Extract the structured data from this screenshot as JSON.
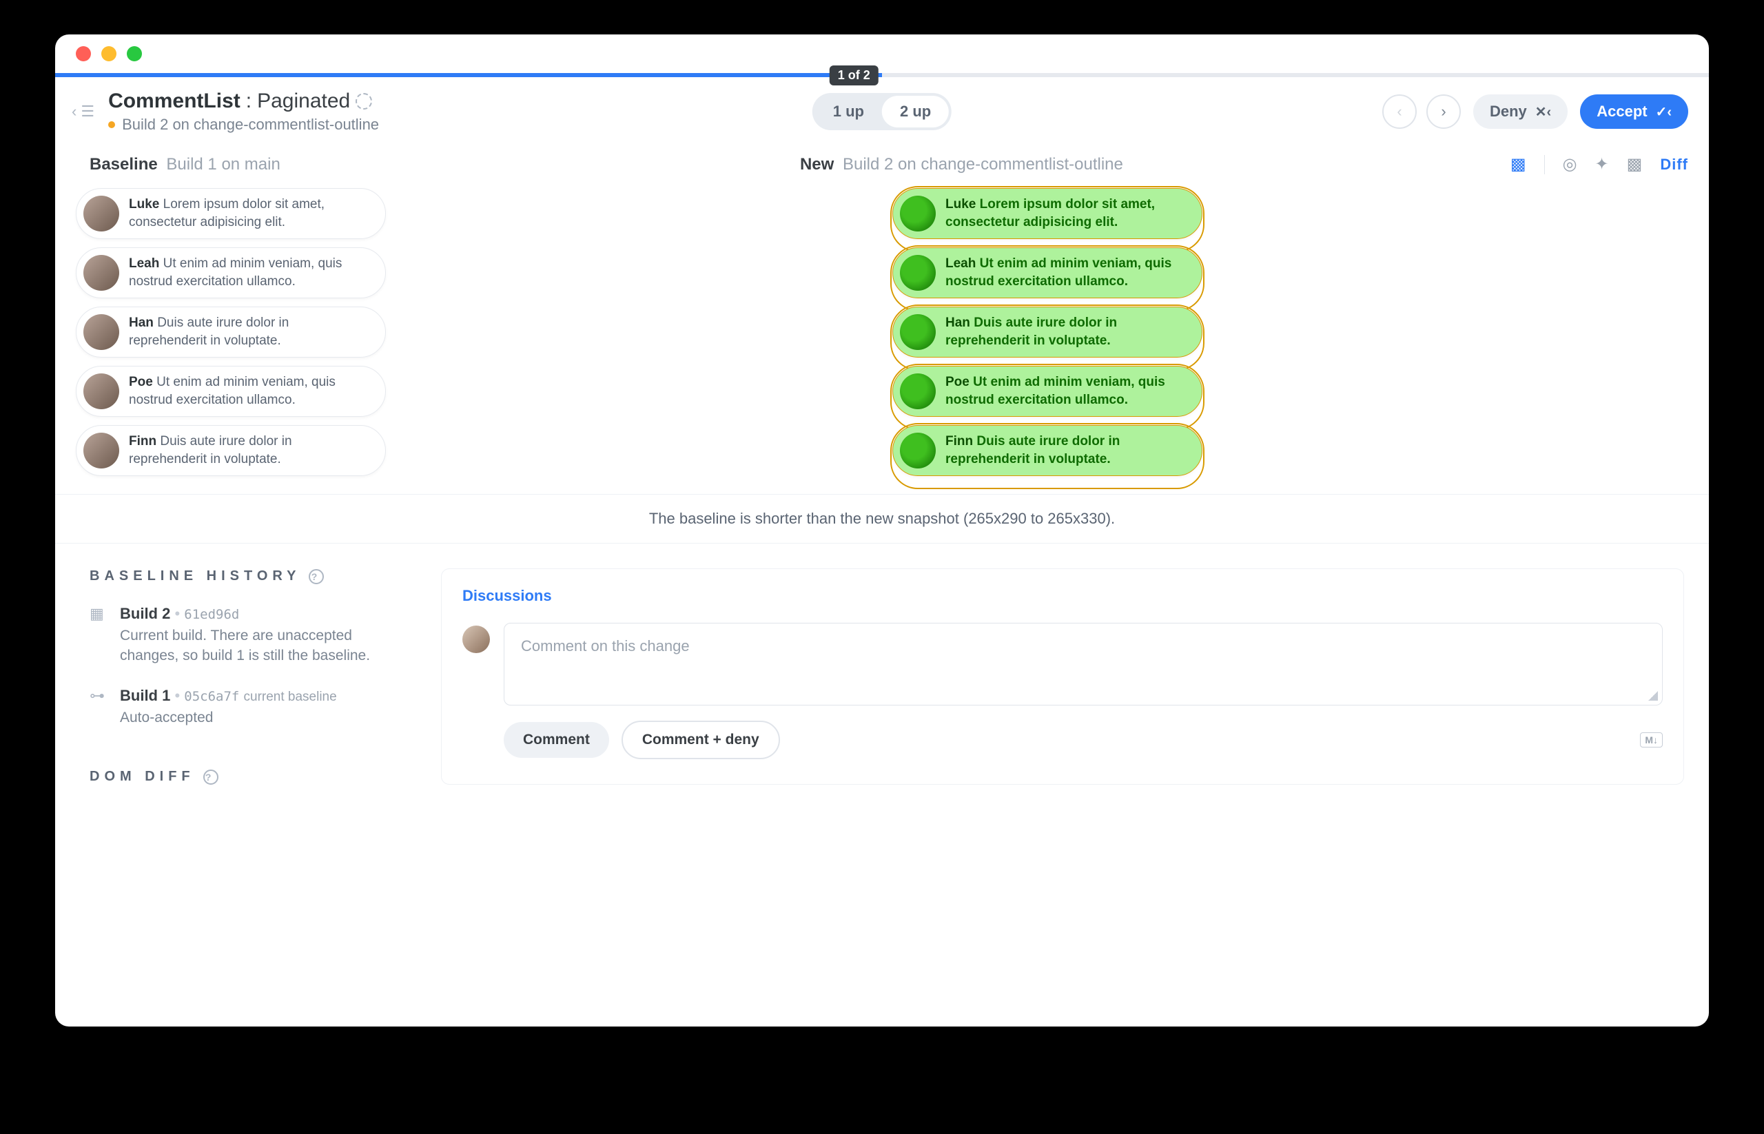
{
  "header": {
    "title_component": "CommentList",
    "title_state": "Paginated",
    "subtitle": "Build 2 on change-commentlist-outline",
    "tooltip": "1 of 2",
    "view_modes": {
      "one_up": "1 up",
      "two_up": "2 up",
      "active": "two_up"
    },
    "deny_label": "Deny",
    "accept_label": "Accept"
  },
  "panels": {
    "baseline_label": "Baseline",
    "baseline_sub": "Build 1 on main",
    "new_label": "New",
    "new_sub": "Build 2 on change-commentlist-outline",
    "diff_label": "Diff"
  },
  "comments": [
    {
      "name": "Luke",
      "text": "Lorem ipsum dolor sit amet, consectetur adipisicing elit."
    },
    {
      "name": "Leah",
      "text": "Ut enim ad minim veniam, quis nostrud exercitation ullamco."
    },
    {
      "name": "Han",
      "text": "Duis aute irure dolor in reprehenderit in voluptate."
    },
    {
      "name": "Poe",
      "text": "Ut enim ad minim veniam, quis nostrud exercitation ullamco."
    },
    {
      "name": "Finn",
      "text": "Duis aute irure dolor in reprehenderit in voluptate."
    }
  ],
  "resize_note": "The baseline is shorter than the new snapshot (265x290 to 265x330).",
  "baseline_history": {
    "heading": "BASELINE HISTORY",
    "items": [
      {
        "title": "Build 2",
        "hash": "61ed96d",
        "tag": "",
        "desc": "Current build. There are unaccepted changes, so build 1 is still the baseline."
      },
      {
        "title": "Build 1",
        "hash": "05c6a7f",
        "tag": "current baseline",
        "desc": "Auto-accepted"
      }
    ]
  },
  "dom_diff_heading": "DOM DIFF",
  "discussion": {
    "tab": "Discussions",
    "placeholder": "Comment on this change",
    "comment_btn": "Comment",
    "comment_deny_btn": "Comment + deny",
    "md_badge": "M↓"
  }
}
